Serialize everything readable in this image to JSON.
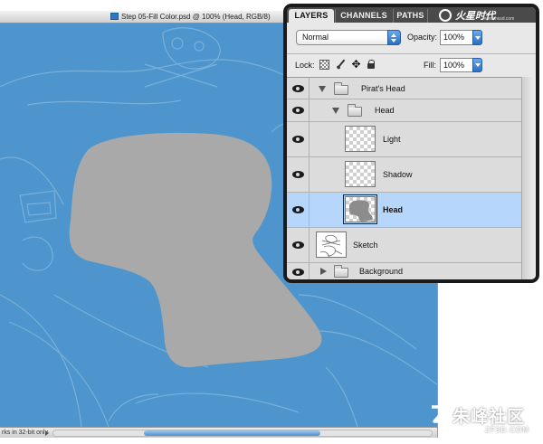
{
  "document": {
    "title": "Step 05-Fill Color.psd @ 100% (Head, RGB/8)",
    "status_text": "rks in 32-bit only",
    "canvas_color": "#4d95cc",
    "shape_color": "#a9a9a9"
  },
  "panel": {
    "tabs": [
      {
        "label": "LAYERS",
        "active": true
      },
      {
        "label": "CHANNELS",
        "active": false
      },
      {
        "label": "PATHS",
        "active": false
      }
    ],
    "logo_text": "火星时代",
    "logo_url": "www.hxsd.com",
    "blend_mode": "Normal",
    "opacity_label": "Opacity:",
    "opacity_value": "100%",
    "lock_label": "Lock:",
    "fill_label": "Fill:",
    "fill_value": "100%",
    "selection_color": "#b7d6fb",
    "lock_icons": [
      "lock-transparent-icon",
      "lock-image-icon",
      "lock-position-icon",
      "lock-all-icon"
    ],
    "layers": [
      {
        "name": "Pirat's Head",
        "kind": "group",
        "expanded": true,
        "depth": 0,
        "visible": true
      },
      {
        "name": "Head",
        "kind": "group",
        "expanded": true,
        "depth": 1,
        "visible": true
      },
      {
        "name": "Light",
        "kind": "layer",
        "thumb": "transparent",
        "depth": 2,
        "visible": true,
        "selected": false
      },
      {
        "name": "Shadow",
        "kind": "layer",
        "thumb": "transparent",
        "depth": 2,
        "visible": true,
        "selected": false
      },
      {
        "name": "Head",
        "kind": "layer",
        "thumb": "head-shape",
        "depth": 2,
        "visible": true,
        "selected": true
      },
      {
        "name": "Sketch",
        "kind": "layer",
        "thumb": "sketch",
        "depth": 0,
        "visible": true,
        "selected": false
      },
      {
        "name": "Background",
        "kind": "group",
        "expanded": false,
        "depth": 0,
        "visible": true
      }
    ]
  },
  "watermark": {
    "text": "朱峰社区",
    "url": "ZF3D.COM"
  }
}
